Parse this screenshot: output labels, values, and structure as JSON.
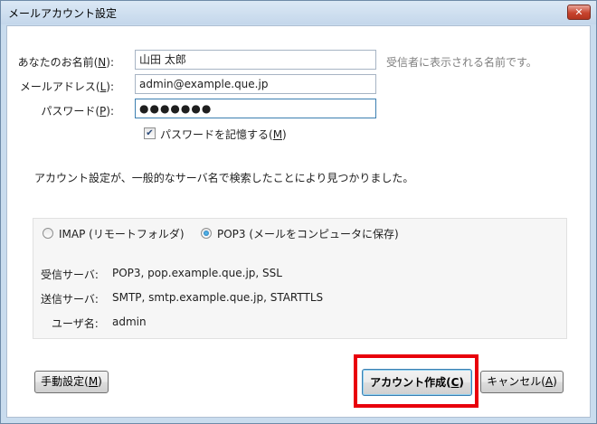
{
  "window": {
    "title": "メールアカウント設定",
    "close": "✕"
  },
  "form": {
    "name_label": "あなたのお名前(",
    "name_key": "N",
    "name_label_end": "):",
    "name_value": "山田 太郎",
    "name_hint": "受信者に表示される名前です。",
    "email_label": "メールアドレス(",
    "email_key": "L",
    "email_label_end": "):",
    "email_value": "admin@example.que.jp",
    "password_label": "パスワード(",
    "password_key": "P",
    "password_label_end": "):",
    "password_value": "●●●●●●●",
    "remember_label": "パスワードを記憶する(",
    "remember_key": "M",
    "remember_label_end": ")",
    "remember_checked": true
  },
  "status_message": "アカウント設定が、一般的なサーバ名で検索したことにより見つかりました。",
  "server": {
    "imap_label": "IMAP (リモートフォルダ)",
    "pop3_label": "POP3 (メールをコンピュータに保存)",
    "selected": "POP3",
    "incoming_label": "受信サーバ:",
    "incoming_value": "POP3, pop.example.que.jp, SSL",
    "outgoing_label": "送信サーバ:",
    "outgoing_value": "SMTP, smtp.example.que.jp, STARTTLS",
    "username_label": "ユーザ名:",
    "username_value": "admin"
  },
  "buttons": {
    "manual_label": "手動設定(",
    "manual_key": "M",
    "manual_end": ")",
    "create_label": "アカウント作成(",
    "create_key": "C",
    "create_end": ")",
    "cancel_label": "キャンセル(",
    "cancel_key": "A",
    "cancel_end": ")"
  },
  "colors": {
    "highlight": "#e8000b",
    "hint_text": "#7f7f7f"
  }
}
